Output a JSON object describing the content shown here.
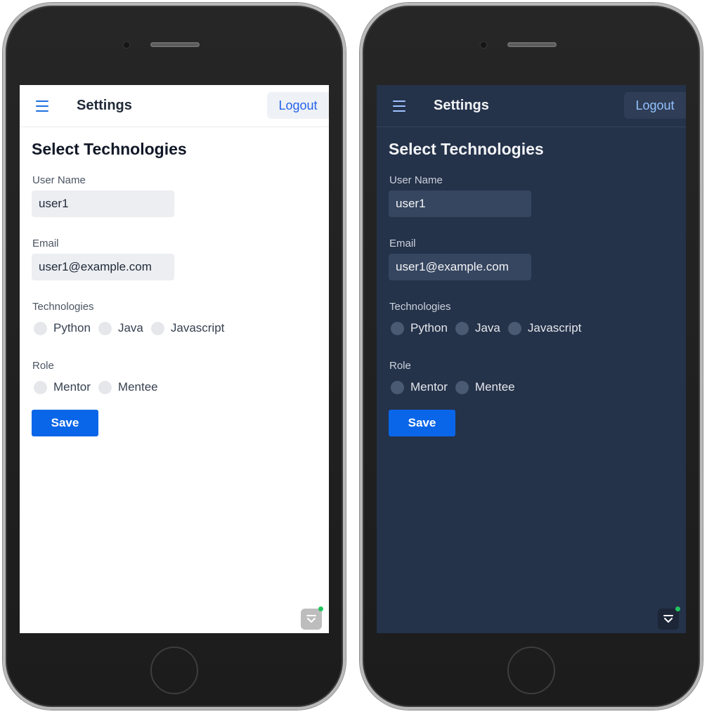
{
  "screens": [
    {
      "theme": "light",
      "appbar": {
        "title": "Settings",
        "logout_label": "Logout"
      },
      "page_title": "Select Technologies",
      "username": {
        "label": "User Name",
        "value": "user1"
      },
      "email": {
        "label": "Email",
        "value": "user1@example.com"
      },
      "technologies": {
        "label": "Technologies",
        "options": [
          "Python",
          "Java",
          "Javascript"
        ]
      },
      "role": {
        "label": "Role",
        "options": [
          "Mentor",
          "Mentee"
        ]
      },
      "save_label": "Save"
    },
    {
      "theme": "dark",
      "appbar": {
        "title": "Settings",
        "logout_label": "Logout"
      },
      "page_title": "Select Technologies",
      "username": {
        "label": "User Name",
        "value": "user1"
      },
      "email": {
        "label": "Email",
        "value": "user1@example.com"
      },
      "technologies": {
        "label": "Technologies",
        "options": [
          "Python",
          "Java",
          "Javascript"
        ]
      },
      "role": {
        "label": "Role",
        "options": [
          "Mentor",
          "Mentee"
        ]
      },
      "save_label": "Save"
    }
  ],
  "colors": {
    "primary": "#0a66e8",
    "dark_background": "#24324a",
    "light_background": "#ffffff",
    "status_dot": "#22c55e"
  },
  "icons": {
    "menu": "hamburger-menu-icon",
    "widget": "chevron-widget-icon"
  }
}
